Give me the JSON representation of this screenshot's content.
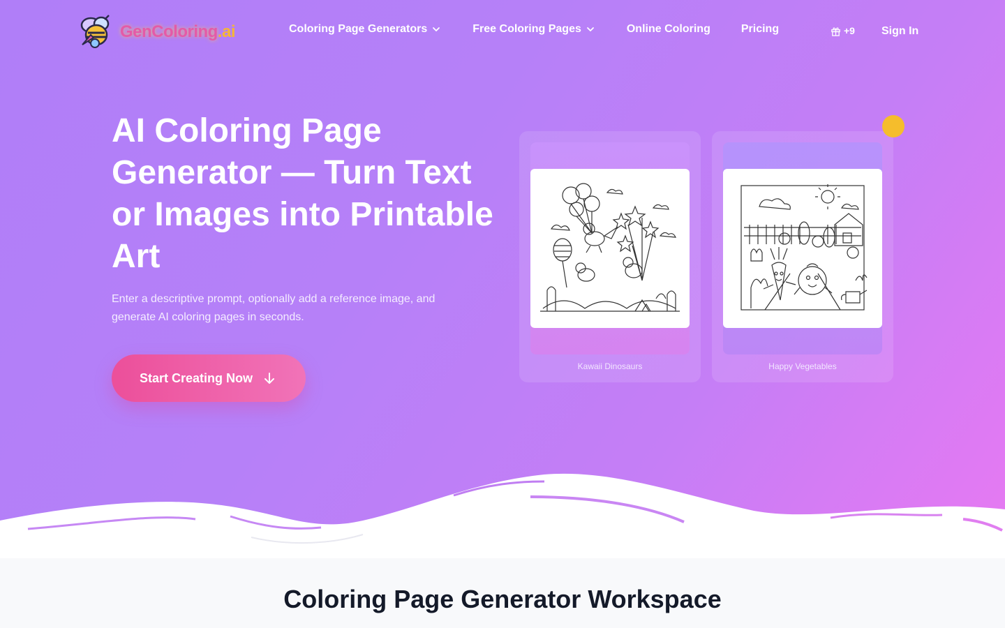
{
  "brand": {
    "name_part1": "GenColoring",
    "name_part2": ".ai"
  },
  "nav": {
    "items": [
      {
        "label": "Coloring Page Generators",
        "dropdown": true
      },
      {
        "label": "Free Coloring Pages",
        "dropdown": true
      },
      {
        "label": "Online Coloring",
        "dropdown": false
      },
      {
        "label": "Pricing",
        "dropdown": false
      }
    ],
    "credits": "+9",
    "sign_in": "Sign In"
  },
  "hero": {
    "title": "AI Coloring Page Generator — Turn Text or Images into Printable Art",
    "subtitle": "Enter a descriptive prompt, optionally add a reference image, and generate AI coloring pages in seconds.",
    "cta_label": "Start Creating Now"
  },
  "gallery": [
    {
      "caption": "Kawaii Dinosaurs"
    },
    {
      "caption": "Happy Vegetables"
    }
  ],
  "section": {
    "title": "Coloring Page Generator Workspace"
  },
  "colors": {
    "accent_pink": "#ec4f9a",
    "brand_yellow": "#f5b637",
    "hero_purple": "#b07ef8",
    "heading_dark": "#141a29"
  }
}
